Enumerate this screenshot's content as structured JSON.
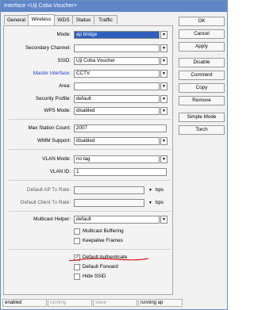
{
  "window": {
    "title": "Interface <Uji Coba Voucher>"
  },
  "tabs": [
    "General",
    "Wireless",
    "WDS",
    "Status",
    "Traffic"
  ],
  "form": {
    "mode": {
      "label": "Mode:",
      "value": "ap bridge"
    },
    "secondary_channel": {
      "label": "Secondary Channel:",
      "value": ""
    },
    "ssid": {
      "label": "SSID:",
      "value": "Uji Coba Voucher"
    },
    "master_interface": {
      "label": "Master Interface:",
      "value": "CCTV"
    },
    "area": {
      "label": "Area:",
      "value": ""
    },
    "security_profile": {
      "label": "Security Profile:",
      "value": "default"
    },
    "wps_mode": {
      "label": "WPS Mode:",
      "value": "disabled"
    },
    "max_station_count": {
      "label": "Max Station Count:",
      "value": "2007"
    },
    "wmm_support": {
      "label": "WMM Support:",
      "value": "disabled"
    },
    "vlan_mode": {
      "label": "VLAN Mode:",
      "value": "no tag"
    },
    "vlan_id": {
      "label": "VLAN ID:",
      "value": "1"
    },
    "default_ap_tx_rate": {
      "label": "Default AP Tx Rate:",
      "value": "",
      "unit": "bps"
    },
    "default_client_tx_rate": {
      "label": "Default Client Tx Rate:",
      "value": "",
      "unit": "bps"
    },
    "multicast_helper": {
      "label": "Multicast Helper:",
      "value": "default"
    }
  },
  "checkboxes": [
    {
      "label": "Multicast Buffering",
      "checked": false
    },
    {
      "label": "Keepalive Frames",
      "checked": false
    },
    {
      "label": "Default Authenticate",
      "checked": true
    },
    {
      "label": "Default Forward",
      "checked": false
    },
    {
      "label": "Hide SSID",
      "checked": false
    }
  ],
  "buttons": [
    "OK",
    "Cancel",
    "Apply",
    "Disable",
    "Comment",
    "Copy",
    "Remove",
    "Simple Mode",
    "Torch"
  ],
  "status": [
    "enabled",
    "running",
    "slave",
    "running ap"
  ],
  "icons": {
    "dropdown": "▼",
    "small_dropdown": "▼",
    "check": "✓"
  },
  "colors": {
    "title_bar": "#5f86c9",
    "selected": "#2f5fbd",
    "link_label": "#1f3fd0",
    "annotation": "#e02020"
  }
}
